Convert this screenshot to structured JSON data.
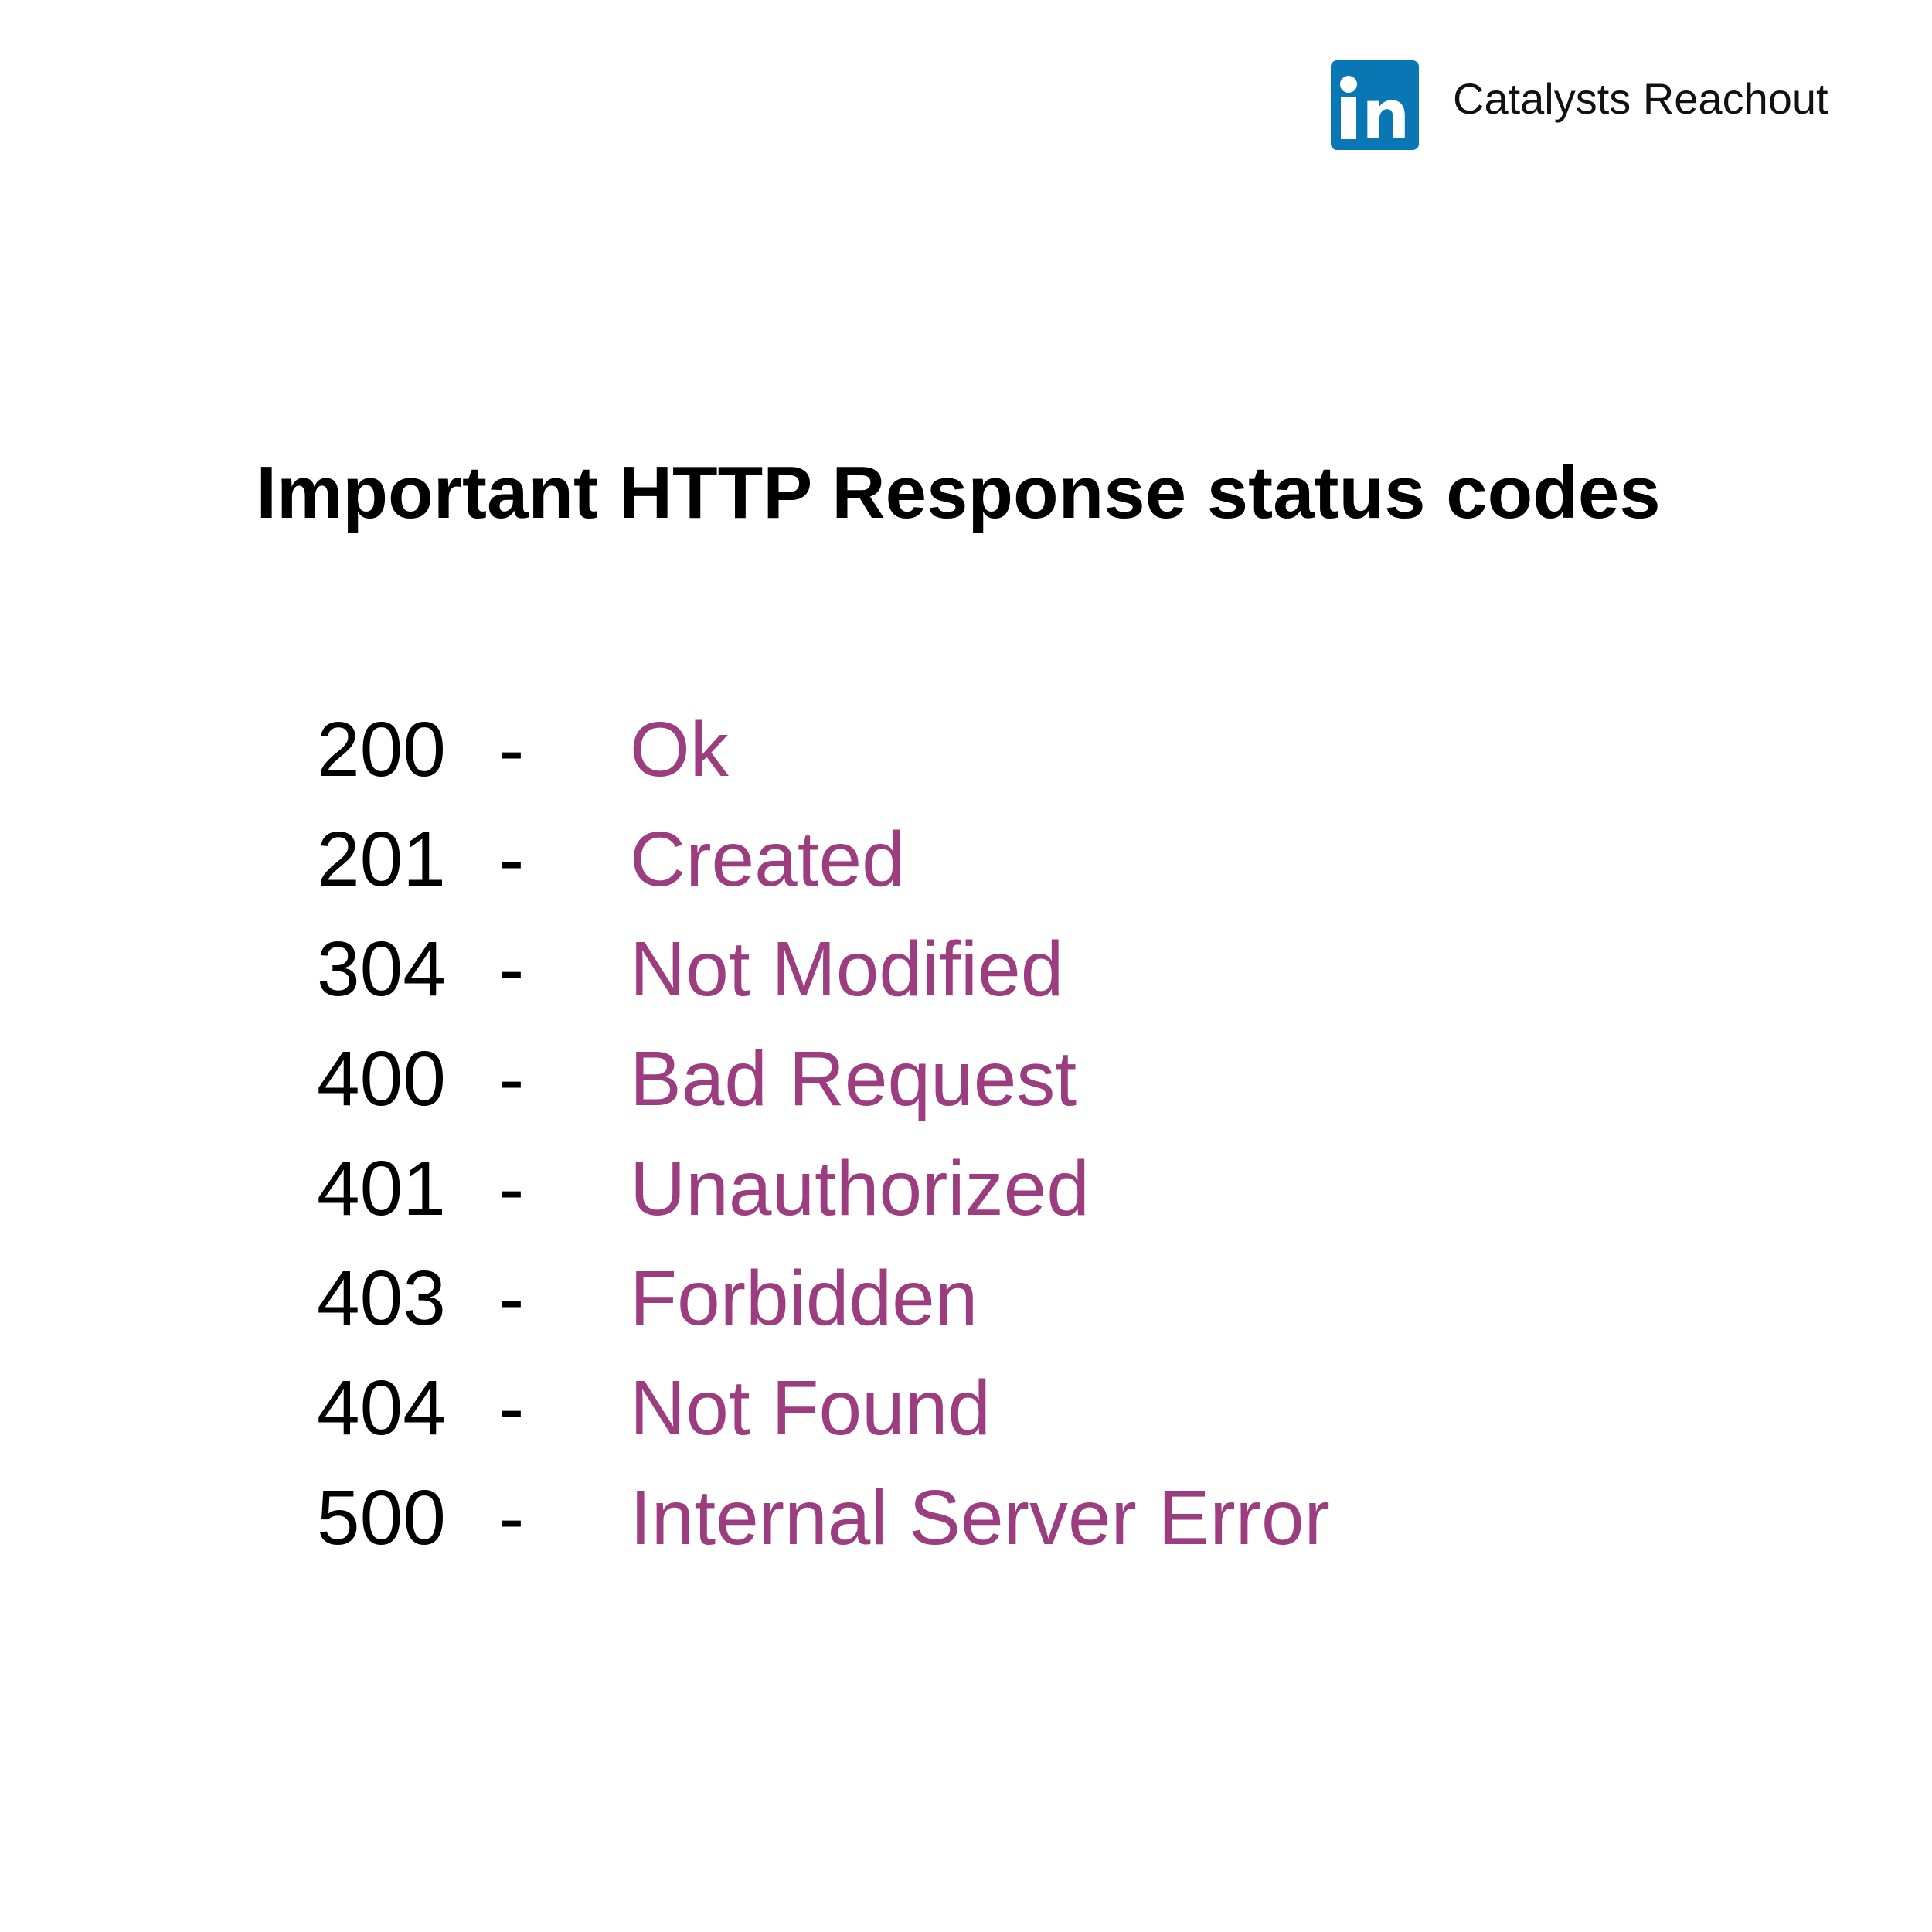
{
  "brand": {
    "name": "Catalysts Reachout",
    "logo_icon": "linkedin-icon",
    "logo_color": "#0a77b5",
    "logo_letters": "in"
  },
  "title": "Important HTTP Response status codes",
  "accent_color": "#9c3d80",
  "separator": "-",
  "codes": [
    {
      "code": "200",
      "description": "Ok"
    },
    {
      "code": "201",
      "description": "Created"
    },
    {
      "code": "304",
      "description": "Not Modified"
    },
    {
      "code": "400",
      "description": "Bad Request"
    },
    {
      "code": "401",
      "description": "Unauthorized"
    },
    {
      "code": "403",
      "description": "Forbidden"
    },
    {
      "code": "404",
      "description": "Not Found"
    },
    {
      "code": "500",
      "description": "Internal Server Error"
    }
  ]
}
